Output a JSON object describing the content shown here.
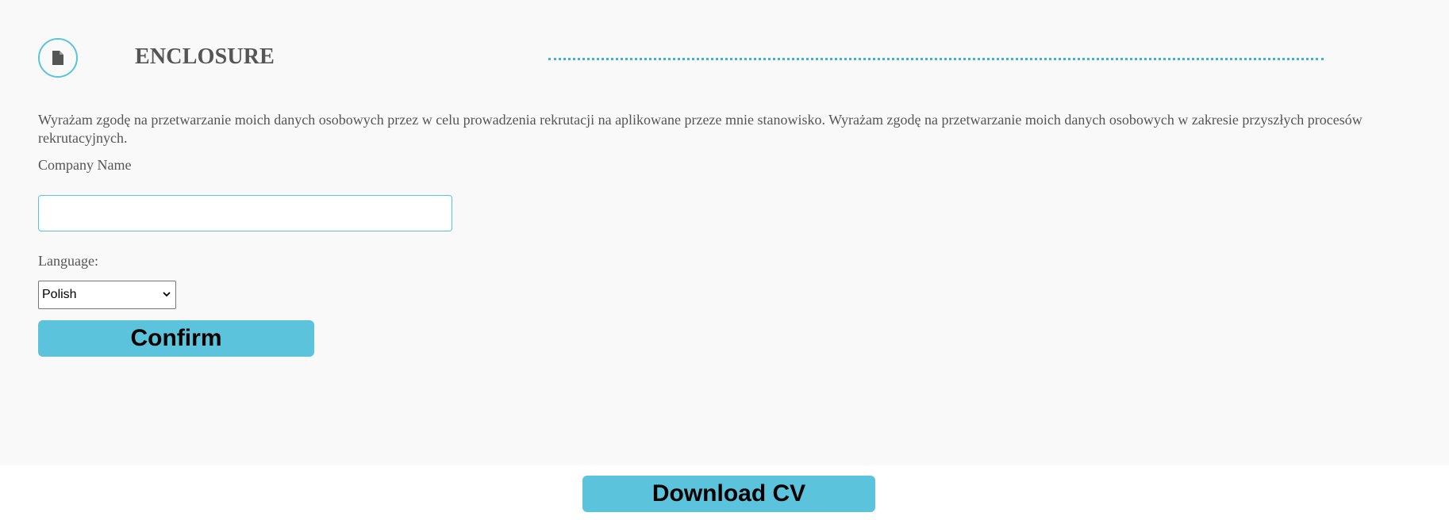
{
  "section": {
    "icon": "document-icon",
    "title": "ENCLOSURE",
    "accent_color": "#5bc4dc"
  },
  "consent": {
    "text": "Wyrażam zgodę na przetwarzanie moich danych osobowych przez w celu prowadzenia rekrutacji na aplikowane przeze mnie stanowisko. Wyrażam zgodę na przetwarzanie moich danych osobowych w zakresie przyszłych procesów rekrutacyjnych."
  },
  "form": {
    "company_label": "Company Name",
    "company_value": "",
    "language_label": "Language:",
    "language_selected": "Polish",
    "confirm_label": "Confirm"
  },
  "footer": {
    "download_label": "Download CV"
  }
}
